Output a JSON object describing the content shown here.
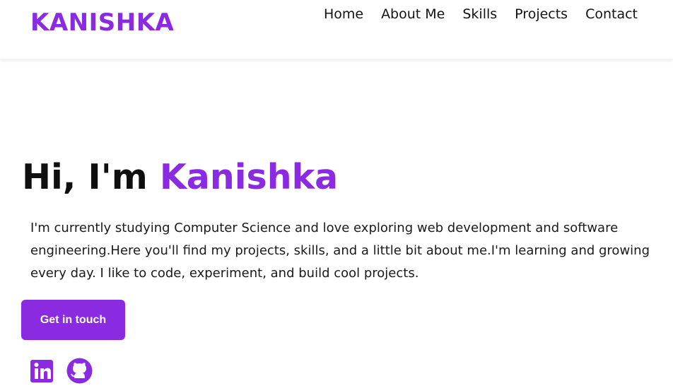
{
  "header": {
    "logo": "KANISHKA",
    "nav": [
      "Home",
      "About Me",
      "Skills",
      "Projects",
      "Contact"
    ]
  },
  "hero": {
    "greeting": "Hi, I'm ",
    "name": "Kanishka",
    "intro": "I'm currently studying Computer Science and love exploring web development and software engineering.Here you'll find my projects, skills, and a little bit about me.I'm learning and growing every day. I like to code, experiment, and build cool projects.",
    "cta_label": "Get in touch"
  },
  "socials": {
    "icons": [
      "linkedin-icon",
      "github-icon"
    ]
  },
  "colors": {
    "accent": "#8a2be2",
    "text": "#111111",
    "background": "#ffffff"
  }
}
